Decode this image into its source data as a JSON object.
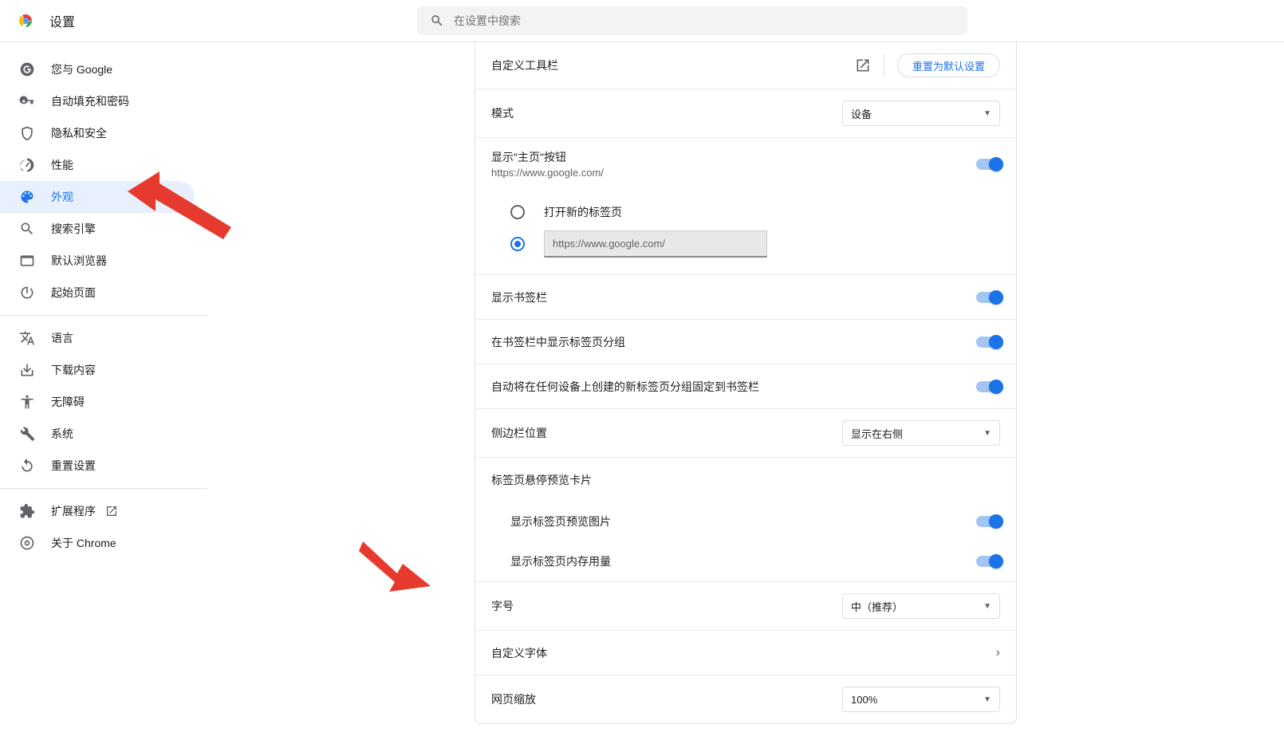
{
  "header": {
    "title": "设置",
    "search_placeholder": "在设置中搜索"
  },
  "sidebar": {
    "items_a": [
      {
        "label": "您与 Google"
      },
      {
        "label": "自动填充和密码"
      },
      {
        "label": "隐私和安全"
      },
      {
        "label": "性能"
      },
      {
        "label": "外观"
      },
      {
        "label": "搜索引擎"
      },
      {
        "label": "默认浏览器"
      },
      {
        "label": "起始页面"
      }
    ],
    "items_b": [
      {
        "label": "语言"
      },
      {
        "label": "下载内容"
      },
      {
        "label": "无障碍"
      },
      {
        "label": "系统"
      },
      {
        "label": "重置设置"
      }
    ],
    "items_c": [
      {
        "label": "扩展程序"
      },
      {
        "label": "关于 Chrome"
      }
    ]
  },
  "main": {
    "custom_toolbar": "自定义工具栏",
    "reset_default": "重置为默认设置",
    "mode_label": "模式",
    "mode_value": "设备",
    "show_home_label": "显示\"主页\"按钮",
    "show_home_url": "https://www.google.com/",
    "radio_newtab": "打开新的标签页",
    "radio_url_value": "https://www.google.com/",
    "show_bookmarks": "显示书签栏",
    "show_tab_groups": "在书签栏中显示标签页分组",
    "auto_pin_groups": "自动将在任何设备上创建的新标签页分组固定到书签栏",
    "side_panel_label": "侧边栏位置",
    "side_panel_value": "显示在右侧",
    "hover_card_title": "标签页悬停预览卡片",
    "show_preview_img": "显示标签页预览图片",
    "show_mem_usage": "显示标签页内存用量",
    "font_size_label": "字号",
    "font_size_value": "中（推荐）",
    "custom_font": "自定义字体",
    "page_zoom_label": "网页缩放",
    "page_zoom_value": "100%"
  }
}
